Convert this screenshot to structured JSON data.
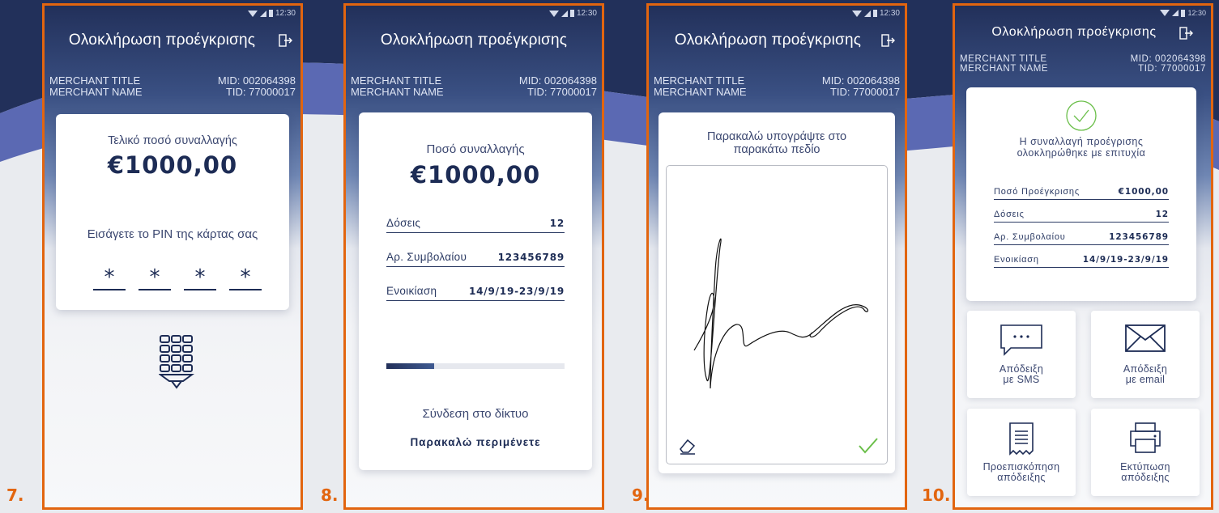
{
  "colors": {
    "accent_border": "#e2650f",
    "navy": "#1d2c55",
    "success": "#6bbf4a"
  },
  "common": {
    "status_time": "12:30",
    "title": "Ολοκλήρωση προέγκρισης",
    "merchant_title": "MERCHANT TITLE",
    "merchant_name": "MERCHANT NAME",
    "mid": "MID: 002064398",
    "tid": "TID: 77000017"
  },
  "screen7": {
    "step": "7.",
    "final_amount_label": "Τελικό ποσό συναλλαγής",
    "amount": "€1000,00",
    "pin_prompt": "Εισάγετε το PIN της κάρτας σας",
    "pin_chars": [
      "*",
      "*",
      "*",
      "*"
    ],
    "keypad_icon": "keypad-icon"
  },
  "screen8": {
    "step": "8.",
    "amount_label": "Ποσό συναλλαγής",
    "amount": "€1000,00",
    "rows": [
      {
        "label": "Δόσεις",
        "value": "12"
      },
      {
        "label": "Αρ. Συμβολαίου",
        "value": "123456789"
      },
      {
        "label": "Ενοικίαση",
        "value": "14/9/19-23/9/19"
      }
    ],
    "progress": 0.27,
    "connecting": "Σύνδεση στο δίκτυο",
    "please_wait": "Παρακαλώ περιμένετε"
  },
  "screen9": {
    "step": "9.",
    "sign_prompt_line1": "Παρακαλώ υπογράψτε στο",
    "sign_prompt_line2": "παρακάτω πεδίο"
  },
  "screen10": {
    "step": "10.",
    "success_line1": "Η συναλλαγή προέγρισης",
    "success_line2": "ολοκληρώθηκε με επιτυχία",
    "rows": [
      {
        "label": "Ποσό Προέγκρισης",
        "value": "€1000,00"
      },
      {
        "label": "Δόσεις",
        "value": "12"
      },
      {
        "label": "Αρ. Συμβολαίου",
        "value": "123456789"
      },
      {
        "label": "Ενοικίαση",
        "value": "14/9/19-23/9/19"
      }
    ],
    "tiles": {
      "sms_line1": "Απόδειξη",
      "sms_line2": "με SMS",
      "email_line1": "Απόδειξη",
      "email_line2": "με email",
      "preview_line1": "Προεπισκόπηση",
      "preview_line2": "απόδειξης",
      "print_line1": "Εκτύπωση",
      "print_line2": "απόδειξης"
    }
  }
}
